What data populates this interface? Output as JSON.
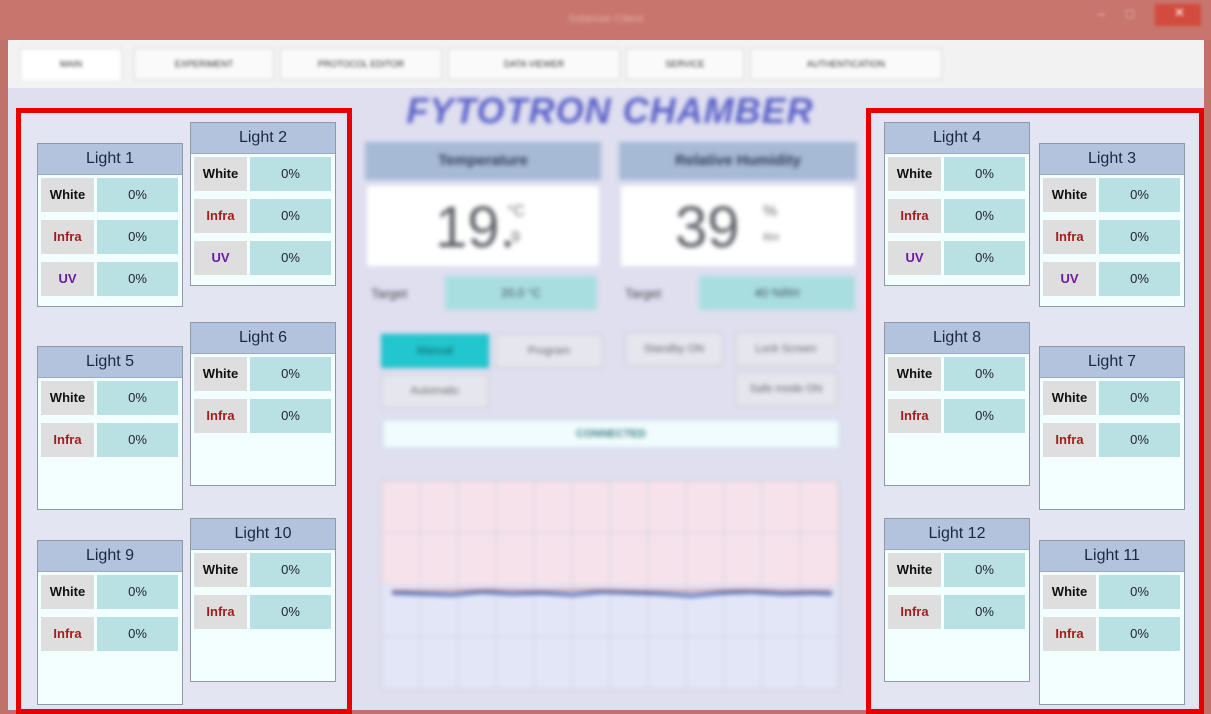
{
  "window": {
    "title": "Solarium Client",
    "controls": {
      "minimize": "–",
      "maximize": "□",
      "close": "✕"
    }
  },
  "tabs": [
    {
      "label": "MAIN",
      "active": true
    },
    {
      "label": "EXPERIMENT"
    },
    {
      "label": "PROTOCOL EDITOR"
    },
    {
      "label": "DATA VIEWER"
    },
    {
      "label": "SERVICE"
    },
    {
      "label": "AUTHENTICATION"
    }
  ],
  "channel_labels": {
    "white": "White",
    "infra": "Infra",
    "uv": "UV"
  },
  "lights": {
    "l1": {
      "name": "Light 1",
      "white": "0%",
      "infra": "0%",
      "uv": "0%"
    },
    "l2": {
      "name": "Light 2",
      "white": "0%",
      "infra": "0%",
      "uv": "0%"
    },
    "l3": {
      "name": "Light 3",
      "white": "0%",
      "infra": "0%",
      "uv": "0%"
    },
    "l4": {
      "name": "Light 4",
      "white": "0%",
      "infra": "0%",
      "uv": "0%"
    },
    "l5": {
      "name": "Light 5",
      "white": "0%",
      "infra": "0%"
    },
    "l6": {
      "name": "Light 6",
      "white": "0%",
      "infra": "0%"
    },
    "l7": {
      "name": "Light 7",
      "white": "0%",
      "infra": "0%"
    },
    "l8": {
      "name": "Light 8",
      "white": "0%",
      "infra": "0%"
    },
    "l9": {
      "name": "Light 9",
      "white": "0%",
      "infra": "0%"
    },
    "l10": {
      "name": "Light 10",
      "white": "0%",
      "infra": "0%"
    },
    "l11": {
      "name": "Light 11",
      "white": "0%",
      "infra": "0%"
    },
    "l12": {
      "name": "Light 12",
      "white": "0%",
      "infra": "0%"
    }
  },
  "center": {
    "title": "FYTOTRON CHAMBER",
    "temperature": {
      "header": "Temperature",
      "value": "19.",
      "unit": "°C",
      "decimal": "9",
      "target_label": "Target",
      "target_value": "20.0 °C"
    },
    "humidity": {
      "header": "Relative Humidity",
      "value": "39",
      "unit": "%",
      "sub": "RH",
      "target_label": "Target",
      "target_value": "40 %RH"
    },
    "buttons": {
      "manual": "Manual",
      "program": "Program",
      "auto": "Automatic",
      "standby": "Standby ON",
      "lock": "Lock Screen",
      "safe": "Safe mode ON"
    },
    "status": "CONNECTED"
  },
  "colors": {
    "highlight_border": "#e60000",
    "light_header": "#b3c2dd",
    "value_cell": "#b9e1e3",
    "infra_text": "#a21e1e",
    "uv_text": "#6c1aa3"
  }
}
